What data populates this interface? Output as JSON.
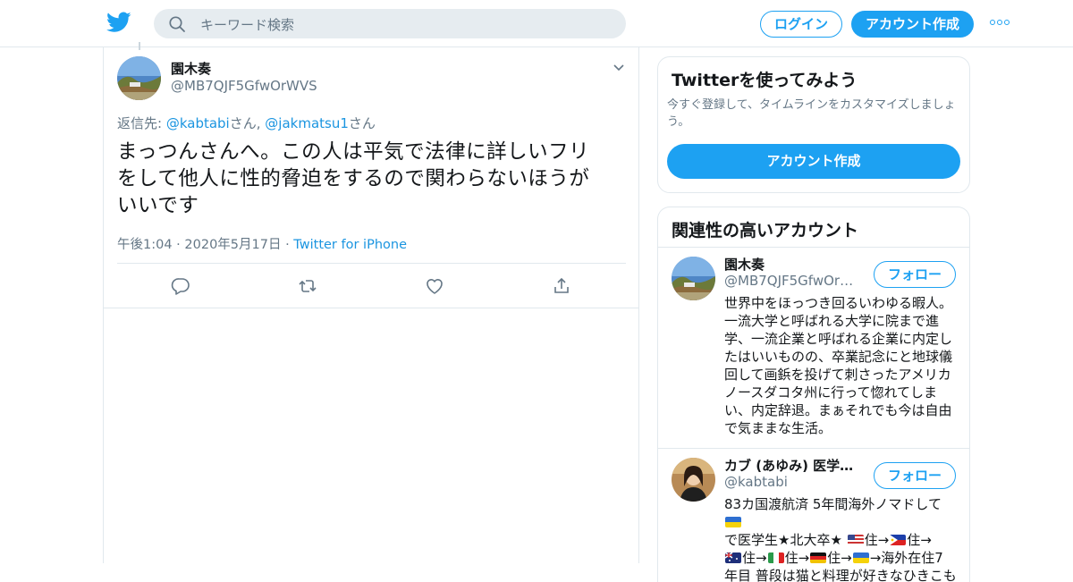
{
  "topbar": {
    "search_placeholder": "キーワード検索",
    "login_label": "ログイン",
    "signup_label": "アカウント作成",
    "accent_color": "#1da1f2"
  },
  "tweet": {
    "author_name": "園木奏",
    "author_handle": "@MB7QJF5GfwOrWVS",
    "reply_prefix": "返信先: ",
    "reply_user1": "@kabtabi",
    "reply_suffix1": "さん, ",
    "reply_user2": "@jakmatsu1",
    "reply_suffix2": "さん",
    "text_line1": "まっつんさんへ。この人は平気で法律に詳しいフリ",
    "text_line2": "をして他人に性的脅迫をするので関わらないほうが",
    "text_line3": "いいです",
    "time": "午後1:04 · 2020年5月17日 · ",
    "source": "Twitter for iPhone",
    "action_icons": [
      "reply-icon",
      "retweet-icon",
      "like-icon",
      "share-icon"
    ]
  },
  "sidebar": {
    "signup_title": "Twitterを使ってみよう",
    "signup_desc": "今すぐ登録して、タイムラインをカスタマイズしましょう。",
    "signup_button": "アカウント作成",
    "related_title": "関連性の高いアカウント",
    "follow_label": "フォロー",
    "accounts": [
      {
        "name": "園木奏",
        "handle": "@MB7QJF5GfwOrWVS",
        "bio": "世界中をほっつき回るいわゆる暇人。一流大学と呼ばれる大学に院まで進学、一流企業と呼ばれる企業に内定したはいいものの、卒業記念にと地球儀回して画鋲を投げて刺さったアメリカノースダコタ州に行って惚れてしまい、内定辞退。まぁそれでも今は自由で気ままな生活。"
      },
      {
        "name": "カブ (あゆみ) 医学生…",
        "handle": "@kabtabi",
        "bio_l1a": "83カ国渡航済 5年間海外ノマドして",
        "bio_l2a": "で医学生★北大卒★ ",
        "bio_l2b": "住→",
        "bio_l2c": "住→",
        "bio_l3a": "住→",
        "bio_l3b": "住→",
        "bio_l3c": "住→",
        "bio_l3d": "→海外在住7",
        "bio_l4": "年目 普段は猫と料理が好きなひきこも"
      }
    ]
  }
}
